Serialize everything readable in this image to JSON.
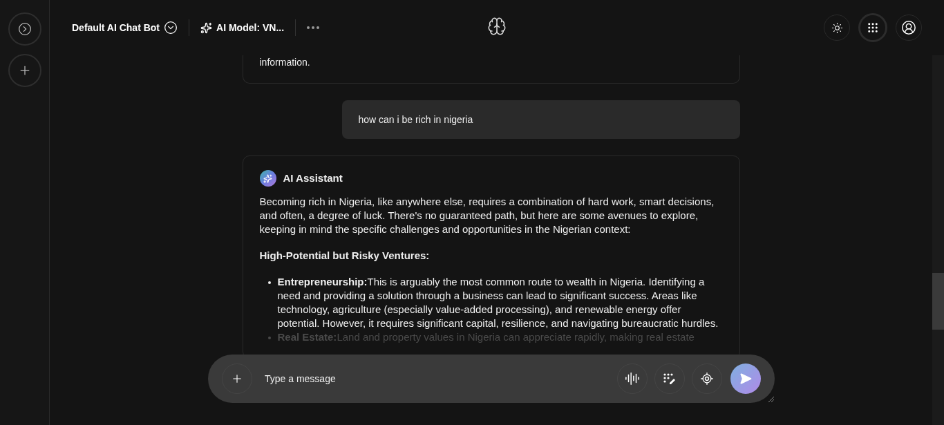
{
  "header": {
    "bot_name": "Default AI Chat Bot",
    "model_label": "AI Model: VN..."
  },
  "messages": [
    {
      "kind": "assistant_tail",
      "text": "information."
    },
    {
      "kind": "user",
      "text": "how can i be rich in nigeria"
    },
    {
      "kind": "assistant",
      "author": "AI Assistant",
      "intro": "Becoming rich in Nigeria, like anywhere else, requires a combination of hard work, smart decisions, and often, a degree of luck. There's no guaranteed path, but here are some avenues to explore, keeping in mind the specific challenges and opportunities in the Nigerian context:",
      "heading": "High-Potential but Risky Ventures:",
      "bullets": [
        {
          "text": "**Entrepreneurship:**This is arguably the most common route to wealth in Nigeria. Identifying a need and providing a solution through a business can lead to significant success. Areas like technology, agriculture (especially value-added processing), and renewable energy offer potential. However, it requires significant capital, resilience, and navigating bureaucratic hurdles.",
          "faded": false
        },
        {
          "text": "**Real Estate:**Land and property values in Nigeria can appreciate rapidly, making real estate",
          "faded": true
        }
      ]
    }
  ],
  "composer": {
    "placeholder": "Type a message"
  }
}
